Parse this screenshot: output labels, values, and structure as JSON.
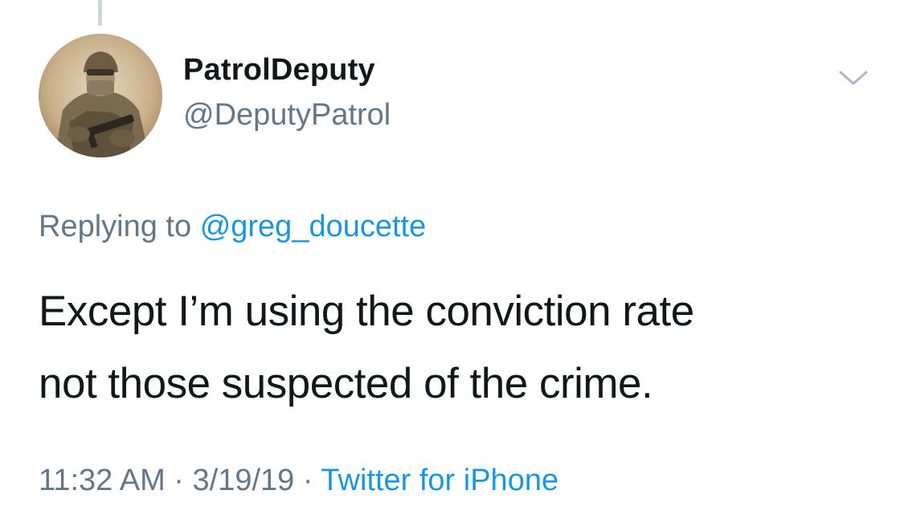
{
  "tweet": {
    "author": {
      "display_name": "PatrolDeputy",
      "handle": "@DeputyPatrol",
      "avatar_icon": "soldier-avatar"
    },
    "reply": {
      "prefix": "Replying to",
      "mention": "@greg_doucette"
    },
    "text_lines": [
      "Except I’m using the conviction rate",
      "not those suspected of the crime."
    ],
    "meta": {
      "time": "11:32 AM",
      "separator": " · ",
      "date": "3/19/19",
      "source": "Twitter for iPhone"
    },
    "menu_icon": "chevron-down-icon"
  },
  "colors": {
    "text_primary": "#14171a",
    "text_secondary": "#657786",
    "link": "#1b95e0",
    "thread_line": "#c9d6df"
  }
}
